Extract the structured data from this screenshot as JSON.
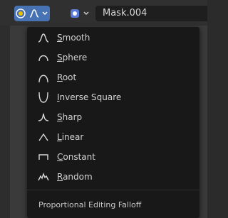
{
  "header": {
    "mask_name": "Mask.004",
    "accent_color": "#4772b3"
  },
  "menu": {
    "items": [
      {
        "label": "Smooth",
        "icon": "smooth-falloff-icon"
      },
      {
        "label": "Sphere",
        "icon": "sphere-falloff-icon"
      },
      {
        "label": "Root",
        "icon": "root-falloff-icon"
      },
      {
        "label": "Inverse Square",
        "icon": "inverse-square-falloff-icon"
      },
      {
        "label": "Sharp",
        "icon": "sharp-falloff-icon"
      },
      {
        "label": "Linear",
        "icon": "linear-falloff-icon"
      },
      {
        "label": "Constant",
        "icon": "constant-falloff-icon"
      },
      {
        "label": "Random",
        "icon": "random-falloff-icon"
      }
    ],
    "title": "Proportional Editing Falloff"
  }
}
